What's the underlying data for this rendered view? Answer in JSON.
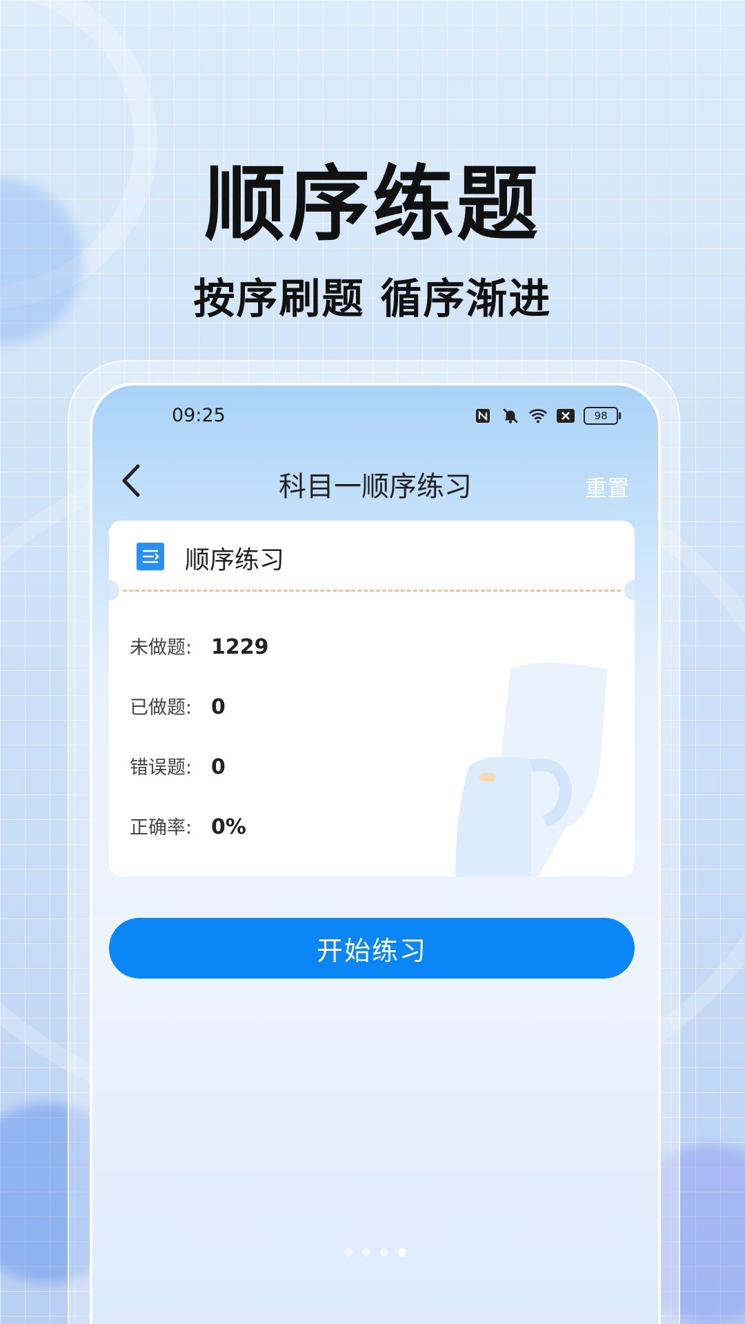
{
  "promo": {
    "title": "顺序练题",
    "subtitle": "按序刷题 循序渐进"
  },
  "status_bar": {
    "time": "09:25",
    "battery": "98",
    "icons": [
      "nfc-icon",
      "bell-muted-icon",
      "wifi-icon",
      "sim-off-icon",
      "battery-icon"
    ]
  },
  "nav": {
    "title": "科目一顺序练习",
    "reset_label": "重置",
    "back_icon": "chevron-left-icon"
  },
  "card": {
    "title": "顺序练习",
    "stats": [
      {
        "label": "未做题:",
        "value": "1229"
      },
      {
        "label": "已做题:",
        "value": "0"
      },
      {
        "label": "错误题:",
        "value": "0"
      },
      {
        "label": "正确率:",
        "value": "0%"
      }
    ]
  },
  "start_button": {
    "label": "开始练习"
  },
  "pager": {
    "count": 4,
    "active_index": 3
  },
  "colors": {
    "accent": "#0a86f7",
    "divider": "#e8c488",
    "title_text": "#111111"
  }
}
